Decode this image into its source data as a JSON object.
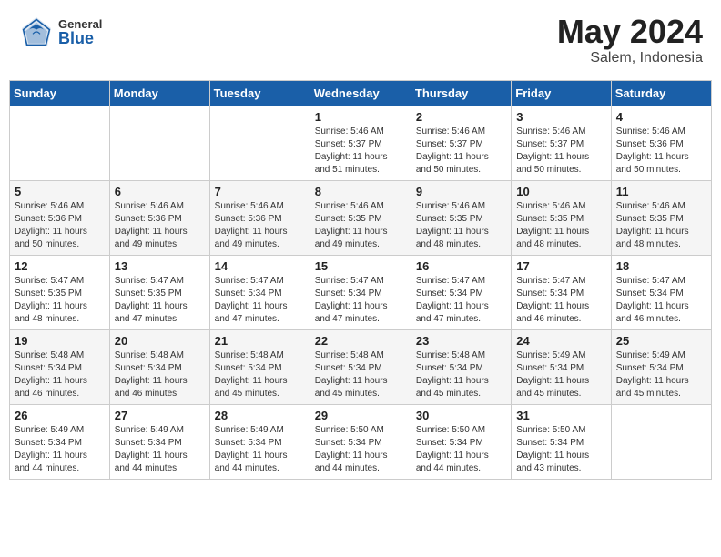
{
  "header": {
    "logo_general": "General",
    "logo_blue": "Blue",
    "month": "May 2024",
    "location": "Salem, Indonesia"
  },
  "calendar": {
    "days_of_week": [
      "Sunday",
      "Monday",
      "Tuesday",
      "Wednesday",
      "Thursday",
      "Friday",
      "Saturday"
    ],
    "weeks": [
      [
        {
          "day": "",
          "info": ""
        },
        {
          "day": "",
          "info": ""
        },
        {
          "day": "",
          "info": ""
        },
        {
          "day": "1",
          "info": "Sunrise: 5:46 AM\nSunset: 5:37 PM\nDaylight: 11 hours\nand 51 minutes."
        },
        {
          "day": "2",
          "info": "Sunrise: 5:46 AM\nSunset: 5:37 PM\nDaylight: 11 hours\nand 50 minutes."
        },
        {
          "day": "3",
          "info": "Sunrise: 5:46 AM\nSunset: 5:37 PM\nDaylight: 11 hours\nand 50 minutes."
        },
        {
          "day": "4",
          "info": "Sunrise: 5:46 AM\nSunset: 5:36 PM\nDaylight: 11 hours\nand 50 minutes."
        }
      ],
      [
        {
          "day": "5",
          "info": "Sunrise: 5:46 AM\nSunset: 5:36 PM\nDaylight: 11 hours\nand 50 minutes."
        },
        {
          "day": "6",
          "info": "Sunrise: 5:46 AM\nSunset: 5:36 PM\nDaylight: 11 hours\nand 49 minutes."
        },
        {
          "day": "7",
          "info": "Sunrise: 5:46 AM\nSunset: 5:36 PM\nDaylight: 11 hours\nand 49 minutes."
        },
        {
          "day": "8",
          "info": "Sunrise: 5:46 AM\nSunset: 5:35 PM\nDaylight: 11 hours\nand 49 minutes."
        },
        {
          "day": "9",
          "info": "Sunrise: 5:46 AM\nSunset: 5:35 PM\nDaylight: 11 hours\nand 48 minutes."
        },
        {
          "day": "10",
          "info": "Sunrise: 5:46 AM\nSunset: 5:35 PM\nDaylight: 11 hours\nand 48 minutes."
        },
        {
          "day": "11",
          "info": "Sunrise: 5:46 AM\nSunset: 5:35 PM\nDaylight: 11 hours\nand 48 minutes."
        }
      ],
      [
        {
          "day": "12",
          "info": "Sunrise: 5:47 AM\nSunset: 5:35 PM\nDaylight: 11 hours\nand 48 minutes."
        },
        {
          "day": "13",
          "info": "Sunrise: 5:47 AM\nSunset: 5:35 PM\nDaylight: 11 hours\nand 47 minutes."
        },
        {
          "day": "14",
          "info": "Sunrise: 5:47 AM\nSunset: 5:34 PM\nDaylight: 11 hours\nand 47 minutes."
        },
        {
          "day": "15",
          "info": "Sunrise: 5:47 AM\nSunset: 5:34 PM\nDaylight: 11 hours\nand 47 minutes."
        },
        {
          "day": "16",
          "info": "Sunrise: 5:47 AM\nSunset: 5:34 PM\nDaylight: 11 hours\nand 47 minutes."
        },
        {
          "day": "17",
          "info": "Sunrise: 5:47 AM\nSunset: 5:34 PM\nDaylight: 11 hours\nand 46 minutes."
        },
        {
          "day": "18",
          "info": "Sunrise: 5:47 AM\nSunset: 5:34 PM\nDaylight: 11 hours\nand 46 minutes."
        }
      ],
      [
        {
          "day": "19",
          "info": "Sunrise: 5:48 AM\nSunset: 5:34 PM\nDaylight: 11 hours\nand 46 minutes."
        },
        {
          "day": "20",
          "info": "Sunrise: 5:48 AM\nSunset: 5:34 PM\nDaylight: 11 hours\nand 46 minutes."
        },
        {
          "day": "21",
          "info": "Sunrise: 5:48 AM\nSunset: 5:34 PM\nDaylight: 11 hours\nand 45 minutes."
        },
        {
          "day": "22",
          "info": "Sunrise: 5:48 AM\nSunset: 5:34 PM\nDaylight: 11 hours\nand 45 minutes."
        },
        {
          "day": "23",
          "info": "Sunrise: 5:48 AM\nSunset: 5:34 PM\nDaylight: 11 hours\nand 45 minutes."
        },
        {
          "day": "24",
          "info": "Sunrise: 5:49 AM\nSunset: 5:34 PM\nDaylight: 11 hours\nand 45 minutes."
        },
        {
          "day": "25",
          "info": "Sunrise: 5:49 AM\nSunset: 5:34 PM\nDaylight: 11 hours\nand 45 minutes."
        }
      ],
      [
        {
          "day": "26",
          "info": "Sunrise: 5:49 AM\nSunset: 5:34 PM\nDaylight: 11 hours\nand 44 minutes."
        },
        {
          "day": "27",
          "info": "Sunrise: 5:49 AM\nSunset: 5:34 PM\nDaylight: 11 hours\nand 44 minutes."
        },
        {
          "day": "28",
          "info": "Sunrise: 5:49 AM\nSunset: 5:34 PM\nDaylight: 11 hours\nand 44 minutes."
        },
        {
          "day": "29",
          "info": "Sunrise: 5:50 AM\nSunset: 5:34 PM\nDaylight: 11 hours\nand 44 minutes."
        },
        {
          "day": "30",
          "info": "Sunrise: 5:50 AM\nSunset: 5:34 PM\nDaylight: 11 hours\nand 44 minutes."
        },
        {
          "day": "31",
          "info": "Sunrise: 5:50 AM\nSunset: 5:34 PM\nDaylight: 11 hours\nand 43 minutes."
        },
        {
          "day": "",
          "info": ""
        }
      ]
    ]
  }
}
